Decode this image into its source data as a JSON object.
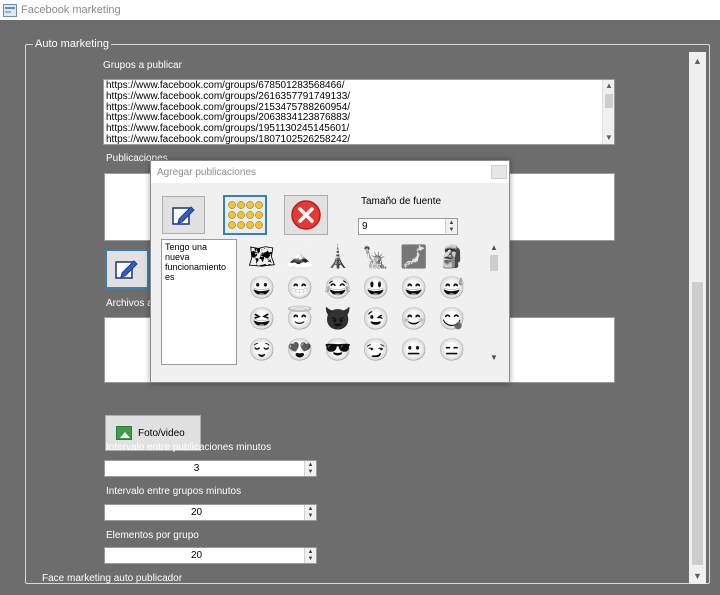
{
  "window": {
    "title": "Facebook marketing"
  },
  "group": {
    "legend": "Auto marketing"
  },
  "groups_section": {
    "label": "Grupos a publicar",
    "urls": [
      "https://www.facebook.com/groups/678501283568466/",
      "https://www.facebook.com/groups/2616357791749133/",
      "https://www.facebook.com/groups/2153475788260954/",
      "https://www.facebook.com/groups/2063834123876883/",
      "https://www.facebook.com/groups/1951130245145601/",
      "https://www.facebook.com/groups/1807102526258242/"
    ]
  },
  "publicaciones": {
    "label": "Publicaciones"
  },
  "archivos": {
    "label": "Archivos a"
  },
  "foto_button": {
    "label": "Foto/video"
  },
  "intervals": {
    "publicaciones_label": "Intervalo entre publicaciones minutos",
    "publicaciones_value": "3",
    "grupos_label": "Intervalo entre grupos minutos",
    "grupos_value": "20",
    "elementos_label": "Elementos por grupo",
    "elementos_value": "20"
  },
  "status": {
    "text": "Face marketing auto publicador"
  },
  "dialog": {
    "title": "Agregar publicaciones",
    "font_size_label": "Tamaño de fuente",
    "font_size_value": "9",
    "text_content": "Tengo una nueva funcionamiento es",
    "emojis": [
      "🗺",
      "🗻",
      "🗼",
      "🗽",
      "🗾",
      "🗿",
      "😀",
      "😁",
      "😂",
      "😃",
      "😄",
      "😅",
      "😆",
      "😇",
      "😈",
      "😉",
      "😊",
      "😋",
      "😌",
      "😍",
      "😎",
      "😏",
      "😐",
      "😑"
    ]
  },
  "colors": {
    "window_bg": "#6d6d6d",
    "accent_border": "#3c7fb1",
    "delete_red": "#e53935"
  }
}
